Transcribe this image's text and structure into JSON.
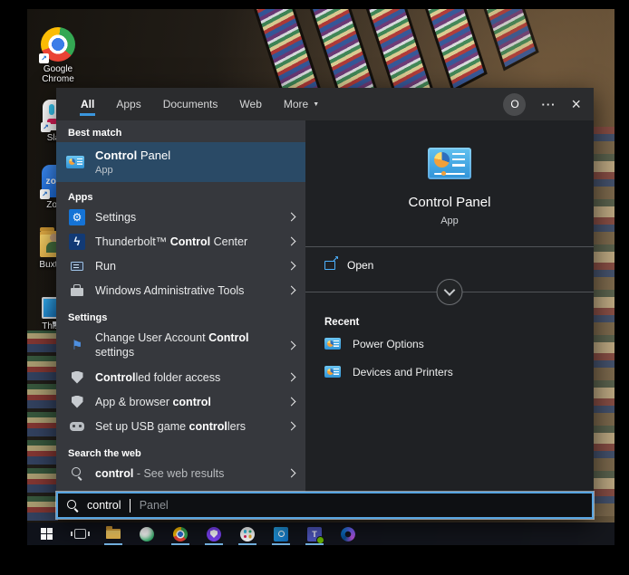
{
  "colors": {
    "accent_underline": "#3a96dd",
    "best_match_highlight": "#2a4a66",
    "taskbar_indicator": "#77b7e7",
    "search_border": "#57a4e0"
  },
  "icons": {
    "dropdown_arrow": "▼",
    "gear": "⚙",
    "flag": "⚑",
    "lightning": "ϟ",
    "shortcut_arrow": "↗",
    "teams_letter": "T"
  },
  "topbar": {
    "avatar_letter": "O",
    "more_glyph": "···",
    "close_glyph": "×"
  },
  "tabs": [
    {
      "label": "All",
      "selected": true
    },
    {
      "label": "Apps",
      "selected": false
    },
    {
      "label": "Documents",
      "selected": false
    },
    {
      "label": "Web",
      "selected": false
    },
    {
      "label": "More",
      "selected": false
    }
  ],
  "best_match": {
    "header": "Best match",
    "item": {
      "match": "Control",
      "suffix": " Panel",
      "subtitle": "App"
    }
  },
  "apps_section": {
    "header": "Apps",
    "items": [
      {
        "prefix": "Settings",
        "match": "",
        "suffix": ""
      },
      {
        "prefix": "Thunderbolt™ ",
        "match": "Control",
        "suffix": " Center"
      },
      {
        "prefix": "Run",
        "match": "",
        "suffix": ""
      },
      {
        "prefix": "Windows Administrative Tools",
        "match": "",
        "suffix": ""
      }
    ]
  },
  "settings_section": {
    "header": "Settings",
    "items": [
      {
        "prefix": "Change User Account ",
        "match": "Control",
        "suffix": " settings"
      },
      {
        "prefix": "",
        "match": "Control",
        "suffix": "led folder access"
      },
      {
        "prefix": "App & browser ",
        "match": "control",
        "suffix": ""
      },
      {
        "prefix": "Set up USB game ",
        "match": "control",
        "suffix": "lers"
      }
    ]
  },
  "web_section": {
    "header": "Search the web",
    "item": {
      "match": "control",
      "suffix": " - See web results"
    }
  },
  "search_box": {
    "value": "control",
    "hint": "Panel"
  },
  "right_panel": {
    "app_name": "Control Panel",
    "app_type": "App",
    "open_label": "Open",
    "recent_header": "Recent",
    "recent_items": [
      "Power Options",
      "Devices and Printers"
    ]
  },
  "desktop": {
    "icons": [
      {
        "label": "Google Chrome"
      },
      {
        "label": "Slack"
      },
      {
        "label": "Zoom",
        "icon_text": "zoom"
      },
      {
        "label": "Buxton C"
      },
      {
        "label": "This PC"
      }
    ]
  },
  "taskbar": {
    "items": [
      {
        "name": "start",
        "active": false
      },
      {
        "name": "task-view",
        "active": false
      },
      {
        "name": "file-explorer",
        "active": true
      },
      {
        "name": "browser-globe",
        "active": false
      },
      {
        "name": "chrome",
        "active": true
      },
      {
        "name": "secure-browser",
        "active": true
      },
      {
        "name": "slack",
        "active": true
      },
      {
        "name": "outlook",
        "active": true
      },
      {
        "name": "teams",
        "active": true
      },
      {
        "name": "microsoft-365",
        "active": false
      }
    ]
  }
}
